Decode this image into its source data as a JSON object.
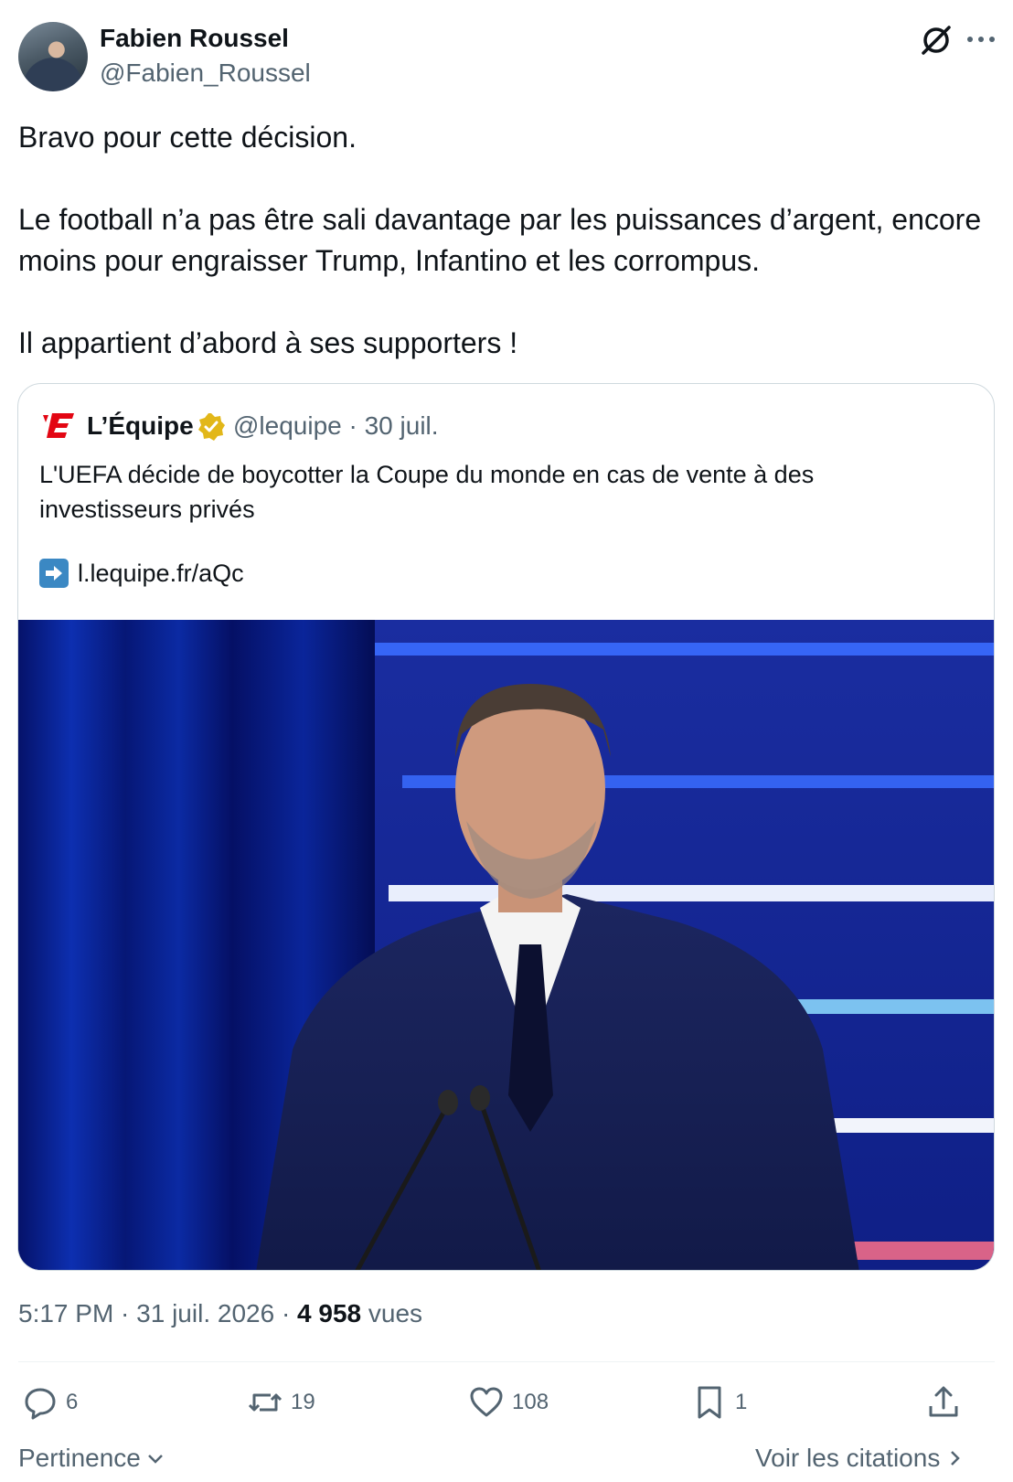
{
  "author": {
    "name": "Fabien Roussel",
    "handle": "@Fabien_Roussel",
    "avatar_icon": "avatar-photo"
  },
  "header_icons": [
    "grok-icon",
    "more-icon"
  ],
  "tweet": {
    "paragraphs": [
      "Bravo pour cette décision.",
      "Le football n’a pas être sali davantage par les puissances d’argent, encore moins pour engraisser Trump, Infantino et les corrompus.",
      "Il appartient d’abord à ses supporters !"
    ]
  },
  "quote": {
    "name": "L’Équipe",
    "verified_color": "#e2b719",
    "handle_date": "@lequipe · 30 juil.",
    "text": "L'UEFA décide de boycotter la Coupe du monde en cas de vente à des investisseurs privés",
    "link": "l.lequipe.fr/aQc",
    "brand_color": "#e30613"
  },
  "meta": {
    "time_date": "5:17 PM · 31 juil. 2026 · ",
    "views_count": "4 958",
    "views_label": " vues"
  },
  "actions": {
    "replies": "6",
    "reposts": "19",
    "likes": "108",
    "bookmarks": "1"
  },
  "footer": {
    "sort_label": "Pertinence",
    "quotes_label": "Voir les citations"
  }
}
